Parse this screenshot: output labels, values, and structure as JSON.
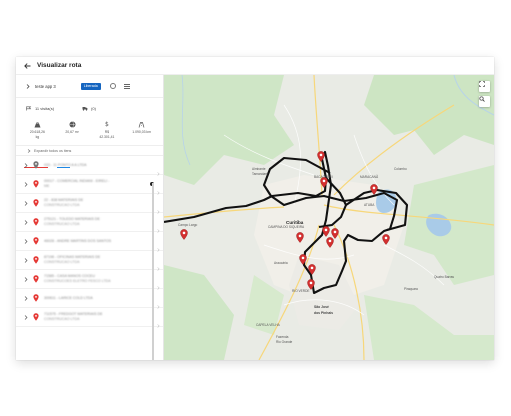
{
  "header": {
    "title": "Visualizar rota"
  },
  "route": {
    "name": "teste app 3",
    "status": "Liberada"
  },
  "counts": {
    "visits": "11 visita(s)",
    "trips": "(0)"
  },
  "stats": [
    {
      "icon": "weight-icon",
      "line1": "20.618,26",
      "line2": "kg"
    },
    {
      "icon": "volume-icon",
      "line1": "20,67 m³",
      "line2": ""
    },
    {
      "icon": "dollar-icon",
      "line1": "R$",
      "line2": "42.301,41"
    },
    {
      "icon": "truck-distance-icon",
      "line1": "1.090,03 km",
      "line2": ""
    }
  ],
  "expand_all": "Expandir todos os itens",
  "items": [
    {
      "line1": "033 - 11 PONTO A A LTDA",
      "line2": "",
      "dot": false
    },
    {
      "line1": "00017 - COMERCIAL INDIANI - EIRELI -",
      "line2": "ME",
      "dot": true
    },
    {
      "line1": "22 - 838 MATERIAIS DE",
      "line2": "CONSTRUCAO LTDA",
      "dot": false
    },
    {
      "line1": "275121 - TOLEDO MATERIAIS DE",
      "line2": "CONSTRUCAO LTDA",
      "dot": false
    },
    {
      "line1": "46028 - ANDRE MARTINS DOS SANTOS",
      "line2": "",
      "dot": false
    },
    {
      "line1": "87198 - OFICINAS MATERIAIS DE",
      "line2": "CONSTRUCAO LTDA",
      "dot": false
    },
    {
      "line1": "71585 - CASA MANOS COCEU",
      "line2": "CONSTRUCOES ELETRO FESCO LTDA",
      "dot": false
    },
    {
      "line1": "300611 - LARICE COLD LTDA",
      "line2": "",
      "dot": false
    },
    {
      "line1": "711575 - FREDGOT MATERIAIS DE",
      "line2": "CONSTRUCAO LTDA",
      "dot": false
    }
  ],
  "map": {
    "places": [
      {
        "name": "Curitiba",
        "kind": "city"
      },
      {
        "name": "São José",
        "kind": "dis"
      },
      {
        "name": "dos Pinhais",
        "kind": "dis"
      },
      {
        "name": "Campo Largo",
        "kind": "small"
      },
      {
        "name": "Colombo",
        "kind": "small"
      },
      {
        "name": "Almirante",
        "kind": "small"
      },
      {
        "name": "Tamandaré",
        "kind": "small"
      },
      {
        "name": "Araucária",
        "kind": "small"
      },
      {
        "name": "Piraquara",
        "kind": "small"
      },
      {
        "name": "Fazenda",
        "kind": "small"
      },
      {
        "name": "Rio Grande",
        "kind": "small"
      },
      {
        "name": "BACACHERI",
        "kind": "small"
      },
      {
        "name": "CAPELA VELHA",
        "kind": "small"
      },
      {
        "name": "RIO VERDE",
        "kind": "small"
      },
      {
        "name": "MARACANÃ",
        "kind": "small"
      },
      {
        "name": "ATUBA",
        "kind": "small"
      },
      {
        "name": "CAMPINA DO SIQUEIRA",
        "kind": "small"
      },
      {
        "name": "Quatro Barras",
        "kind": "small"
      }
    ]
  }
}
